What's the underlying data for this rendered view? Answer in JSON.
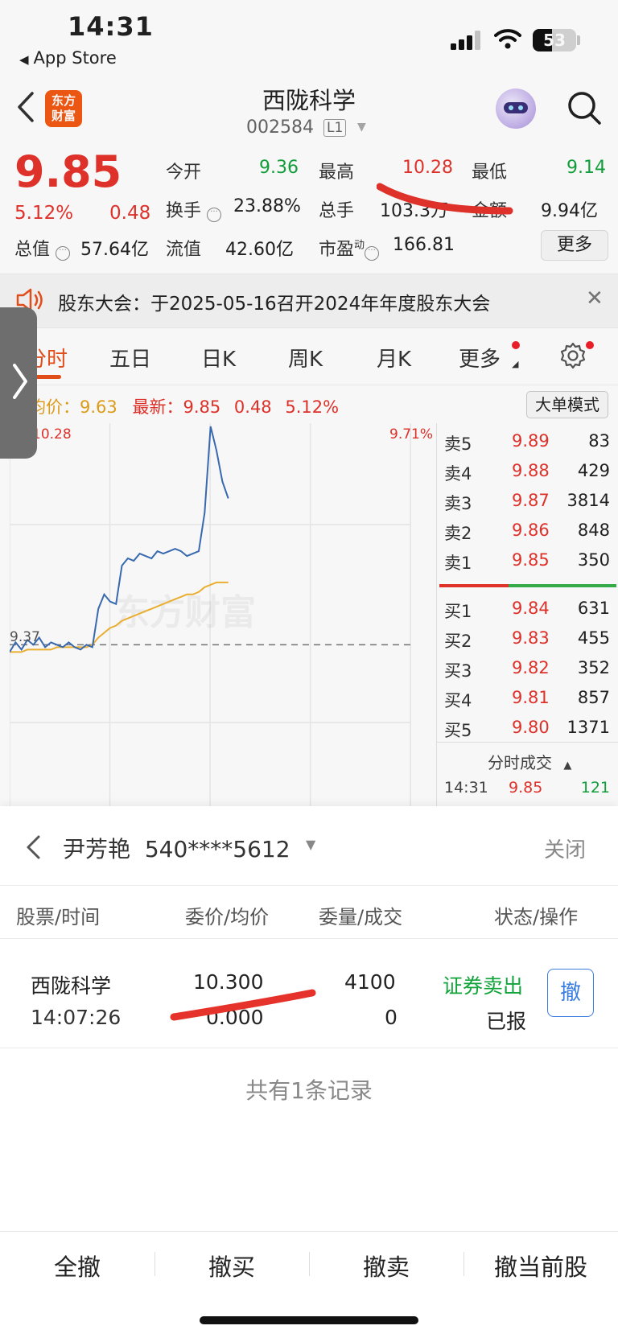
{
  "status_bar": {
    "time": "14:31",
    "back_app": "App Store",
    "battery": "53"
  },
  "header": {
    "stock_name": "西陇科学",
    "stock_code": "002584",
    "level_badge": "L1",
    "logo_text": "东方\n财富"
  },
  "quote": {
    "price": "9.85",
    "change_pct": "5.12%",
    "change": "0.48",
    "open_label": "今开",
    "open": "9.36",
    "high_label": "最高",
    "high": "10.28",
    "low_label": "最低",
    "low": "9.14",
    "turnover_rate_label": "换手",
    "turnover_rate": "23.88%",
    "volume_label": "总手",
    "volume": "103.3万",
    "amount_label": "金额",
    "amount": "9.94亿",
    "market_cap_label": "总值",
    "market_cap": "57.64亿",
    "float_cap_label": "流值",
    "float_cap": "42.60亿",
    "pe_label": "市盈",
    "pe_sup": "动",
    "pe": "166.81",
    "more_button": "更多"
  },
  "announcement": {
    "text": "股东大会：于2025-05-16召开2024年年度股东大会"
  },
  "tabs": [
    "分时",
    "五日",
    "日K",
    "周K",
    "月K",
    "更多"
  ],
  "info_row": {
    "avg_label": "均价：",
    "avg": "9.63",
    "latest_label": "最新：",
    "latest": "9.85",
    "change": "0.48",
    "change_pct": "5.12%"
  },
  "big_order_button": "大单模式",
  "chart": {
    "high_tick": "10.28",
    "high_pct": "9.71%",
    "base_tick": "9.37"
  },
  "chart_data": {
    "type": "line",
    "title": "",
    "series": [
      {
        "values": [
          9.34,
          9.38,
          9.35,
          9.39,
          9.37,
          9.4,
          9.36,
          9.38,
          9.37,
          9.36,
          9.38,
          9.36,
          9.35,
          9.37,
          9.36,
          9.52,
          9.58,
          9.55,
          9.54,
          9.7,
          9.73,
          9.72,
          9.75,
          9.74,
          9.73,
          9.76,
          9.75,
          9.76,
          9.77,
          9.76,
          9.74,
          9.75,
          9.76,
          9.92,
          10.28,
          10.18,
          10.05,
          9.98
        ]
      },
      {
        "values": [
          9.34,
          9.34,
          9.34,
          9.35,
          9.35,
          9.35,
          9.35,
          9.35,
          9.36,
          9.36,
          9.36,
          9.36,
          9.36,
          9.36,
          9.37,
          9.4,
          9.42,
          9.44,
          9.45,
          9.47,
          9.48,
          9.49,
          9.5,
          9.51,
          9.52,
          9.53,
          9.54,
          9.55,
          9.56,
          9.57,
          9.58,
          9.58,
          9.59,
          9.61,
          9.62,
          9.63,
          9.63,
          9.63
        ]
      }
    ],
    "ylim": [
      9.14,
      10.28
    ],
    "grid": true,
    "colors": {
      "price": "#3a6db5",
      "avg": "#f2b433"
    }
  },
  "order_book": {
    "asks": [
      {
        "label": "卖5",
        "price": "9.89",
        "volume": "83"
      },
      {
        "label": "卖4",
        "price": "9.88",
        "volume": "429"
      },
      {
        "label": "卖3",
        "price": "9.87",
        "volume": "3814"
      },
      {
        "label": "卖2",
        "price": "9.86",
        "volume": "848"
      },
      {
        "label": "卖1",
        "price": "9.85",
        "volume": "350"
      }
    ],
    "bids": [
      {
        "label": "买1",
        "price": "9.84",
        "volume": "631"
      },
      {
        "label": "买2",
        "price": "9.83",
        "volume": "455"
      },
      {
        "label": "买3",
        "price": "9.82",
        "volume": "352"
      },
      {
        "label": "买4",
        "price": "9.81",
        "volume": "857"
      },
      {
        "label": "买5",
        "price": "9.80",
        "volume": "1371"
      }
    ],
    "ticks_header": "分时成交",
    "tick": {
      "time": "14:31",
      "price": "9.85",
      "volume": "121"
    }
  },
  "order_sheet": {
    "account_name": "尹芳艳",
    "account_no": "540****5612",
    "close": "关闭",
    "columns": [
      "股票/时间",
      "委价/均价",
      "委量/成交",
      "状态/操作"
    ],
    "row": {
      "stock": "西陇科学",
      "time": "14:07:26",
      "order_price": "10.300",
      "avg_price": "0.000",
      "order_qty": "4100",
      "filled_qty": "0",
      "status_type": "证券卖出",
      "status": "已报",
      "action": "撤"
    },
    "record_count": "共有1条记录",
    "bottom_actions": [
      "全撤",
      "撤买",
      "撤卖",
      "撤当前股"
    ]
  },
  "colors": {
    "up": "#e5332c",
    "down": "#12a33b",
    "accent": "#e8501b",
    "link": "#3a7de0"
  }
}
